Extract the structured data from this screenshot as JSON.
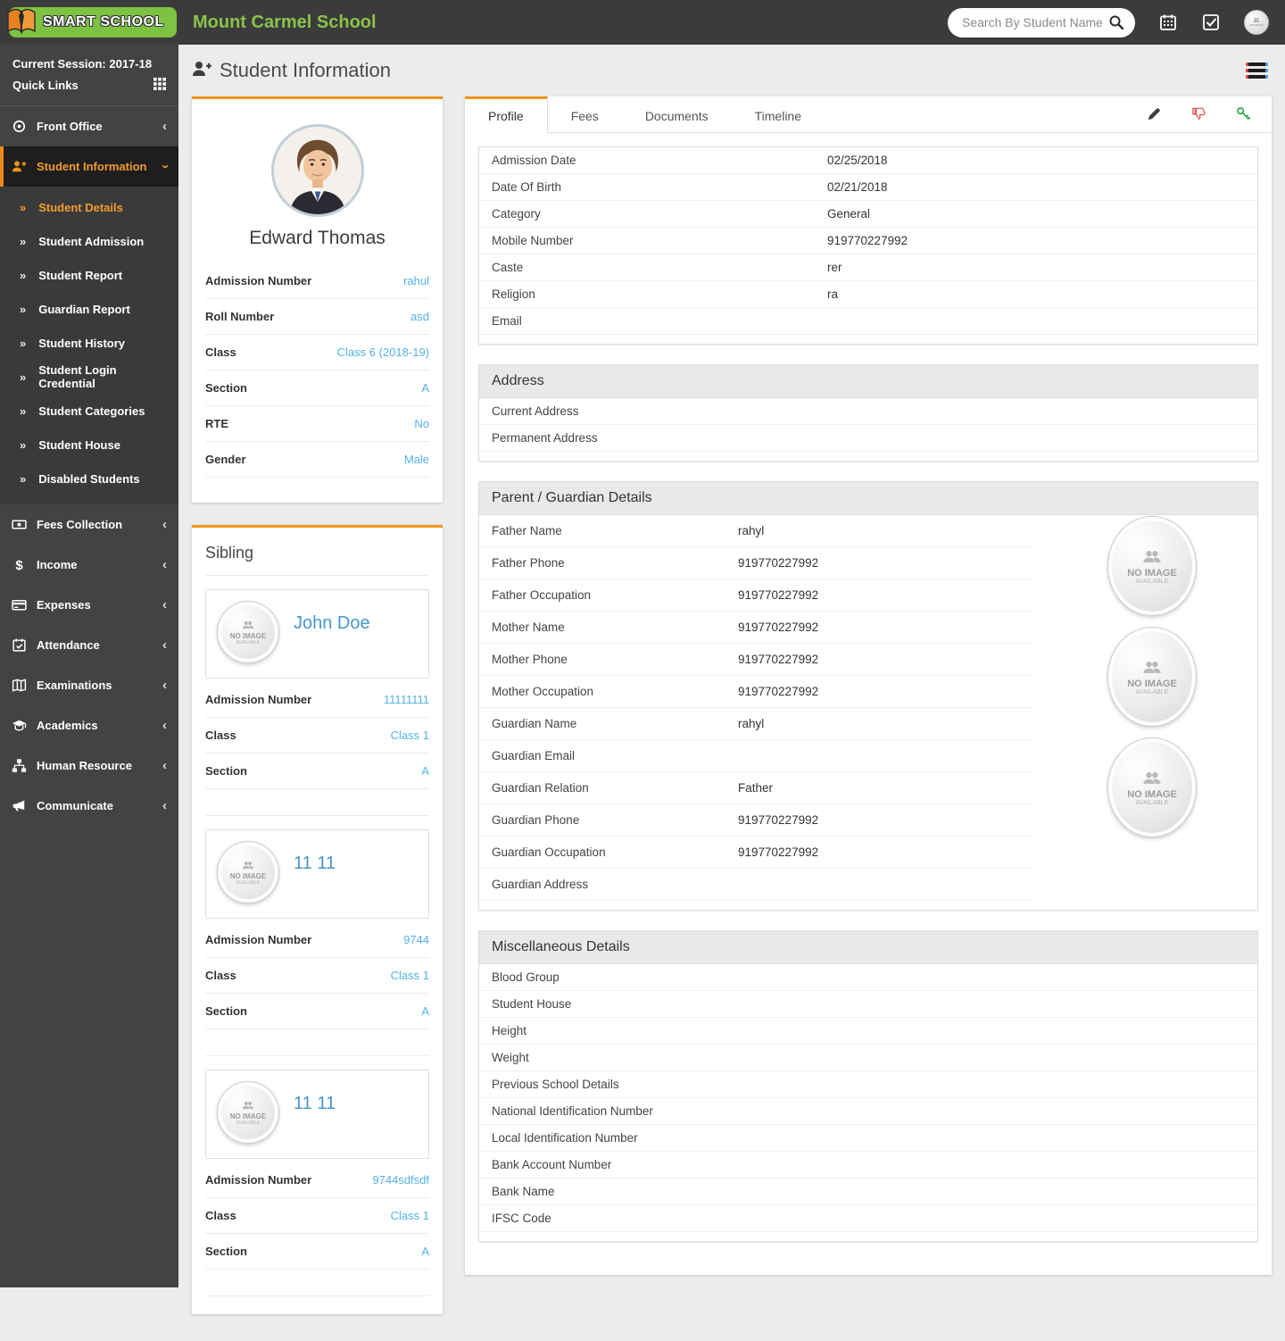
{
  "topbar": {
    "logo_text": "SMART SCHOOL",
    "school_name": "Mount Carmel School",
    "search_placeholder": "Search By Student Name",
    "icons": [
      "search-icon",
      "calendar-icon",
      "tasks-icon",
      "user-avatar"
    ]
  },
  "sidebar": {
    "session_label": "Current Session: 2017-18",
    "quick_links_label": "Quick Links",
    "menu_top": [
      {
        "label": "Front Office",
        "icon": "front-office-icon"
      }
    ],
    "active_group": {
      "label": "Student Information",
      "icon": "student-info-icon"
    },
    "submenu": [
      {
        "label": "Student Details",
        "active": true
      },
      {
        "label": "Student Admission"
      },
      {
        "label": "Student Report"
      },
      {
        "label": "Guardian Report"
      },
      {
        "label": "Student History"
      },
      {
        "label": "Student Login Credential"
      },
      {
        "label": "Student Categories"
      },
      {
        "label": "Student House"
      },
      {
        "label": "Disabled Students"
      }
    ],
    "menu_bottom": [
      {
        "label": "Fees Collection",
        "icon": "fees-icon"
      },
      {
        "label": "Income",
        "icon": "income-icon"
      },
      {
        "label": "Expenses",
        "icon": "expenses-icon"
      },
      {
        "label": "Attendance",
        "icon": "attendance-icon"
      },
      {
        "label": "Examinations",
        "icon": "exams-icon"
      },
      {
        "label": "Academics",
        "icon": "academics-icon"
      },
      {
        "label": "Human Resource",
        "icon": "hr-icon"
      },
      {
        "label": "Communicate",
        "icon": "communicate-icon"
      }
    ]
  },
  "page": {
    "title": "Student Information"
  },
  "no_image": {
    "line1": "NO IMAGE",
    "line2": "AVAILABLE"
  },
  "student_card": {
    "name": "Edward Thomas",
    "rows": [
      {
        "label": "Admission Number",
        "value": "rahul"
      },
      {
        "label": "Roll Number",
        "value": "asd"
      },
      {
        "label": "Class",
        "value": "Class 6 (2018-19)"
      },
      {
        "label": "Section",
        "value": "A"
      },
      {
        "label": "RTE",
        "value": "No"
      },
      {
        "label": "Gender",
        "value": "Male"
      }
    ]
  },
  "sibling_panel": {
    "title": "Sibling",
    "labels": {
      "admission": "Admission Number",
      "class": "Class",
      "section": "Section"
    },
    "siblings": [
      {
        "name": "John Doe",
        "admission_number": "11111111",
        "class": "Class 1",
        "section": "A"
      },
      {
        "name": "11 11",
        "admission_number": "9744",
        "class": "Class 1",
        "section": "A"
      },
      {
        "name": "11 11",
        "admission_number": "9744sdfsdf",
        "class": "Class 1",
        "section": "A"
      }
    ]
  },
  "tabs": [
    {
      "label": "Profile",
      "active": true
    },
    {
      "label": "Fees"
    },
    {
      "label": "Documents"
    },
    {
      "label": "Timeline"
    }
  ],
  "tab_actions": [
    "edit-pencil-icon",
    "disable-thumbsdown-icon",
    "login-key-icon"
  ],
  "profile": {
    "rows": [
      {
        "label": "Admission Date",
        "value": "02/25/2018"
      },
      {
        "label": "Date Of Birth",
        "value": "02/21/2018"
      },
      {
        "label": "Category",
        "value": "General"
      },
      {
        "label": "Mobile Number",
        "value": "919770227992"
      },
      {
        "label": "Caste",
        "value": "rer"
      },
      {
        "label": "Religion",
        "value": "ra"
      },
      {
        "label": "Email",
        "value": ""
      }
    ]
  },
  "address": {
    "title": "Address",
    "rows": [
      {
        "label": "Current Address",
        "value": ""
      },
      {
        "label": "Permanent Address",
        "value": ""
      }
    ]
  },
  "parent": {
    "title": "Parent / Guardian Details",
    "rows": [
      {
        "label": "Father Name",
        "value": "rahyl"
      },
      {
        "label": "Father Phone",
        "value": "919770227992"
      },
      {
        "label": "Father Occupation",
        "value": "919770227992"
      },
      {
        "label": "Mother Name",
        "value": "919770227992"
      },
      {
        "label": "Mother Phone",
        "value": "919770227992"
      },
      {
        "label": "Mother Occupation",
        "value": "919770227992"
      },
      {
        "label": "Guardian Name",
        "value": "rahyl"
      },
      {
        "label": "Guardian Email",
        "value": ""
      },
      {
        "label": "Guardian Relation",
        "value": "Father"
      },
      {
        "label": "Guardian Phone",
        "value": "919770227992"
      },
      {
        "label": "Guardian Occupation",
        "value": "919770227992"
      },
      {
        "label": "Guardian Address",
        "value": ""
      }
    ]
  },
  "misc": {
    "title": "Miscellaneous Details",
    "rows": [
      {
        "label": "Blood Group",
        "value": ""
      },
      {
        "label": "Student House",
        "value": ""
      },
      {
        "label": "Height",
        "value": ""
      },
      {
        "label": "Weight",
        "value": ""
      },
      {
        "label": "Previous School Details",
        "value": ""
      },
      {
        "label": "National Identification Number",
        "value": ""
      },
      {
        "label": "Local Identification Number",
        "value": ""
      },
      {
        "label": "Bank Account Number",
        "value": ""
      },
      {
        "label": "Bank Name",
        "value": ""
      },
      {
        "label": "IFSC Code",
        "value": ""
      }
    ]
  },
  "colors": {
    "accent_orange": "#f0941f",
    "brand_green": "#7dc242",
    "value_blue": "#54b0e8",
    "header_dark": "#3b3b3b",
    "sidebar_dark": "#434343"
  }
}
